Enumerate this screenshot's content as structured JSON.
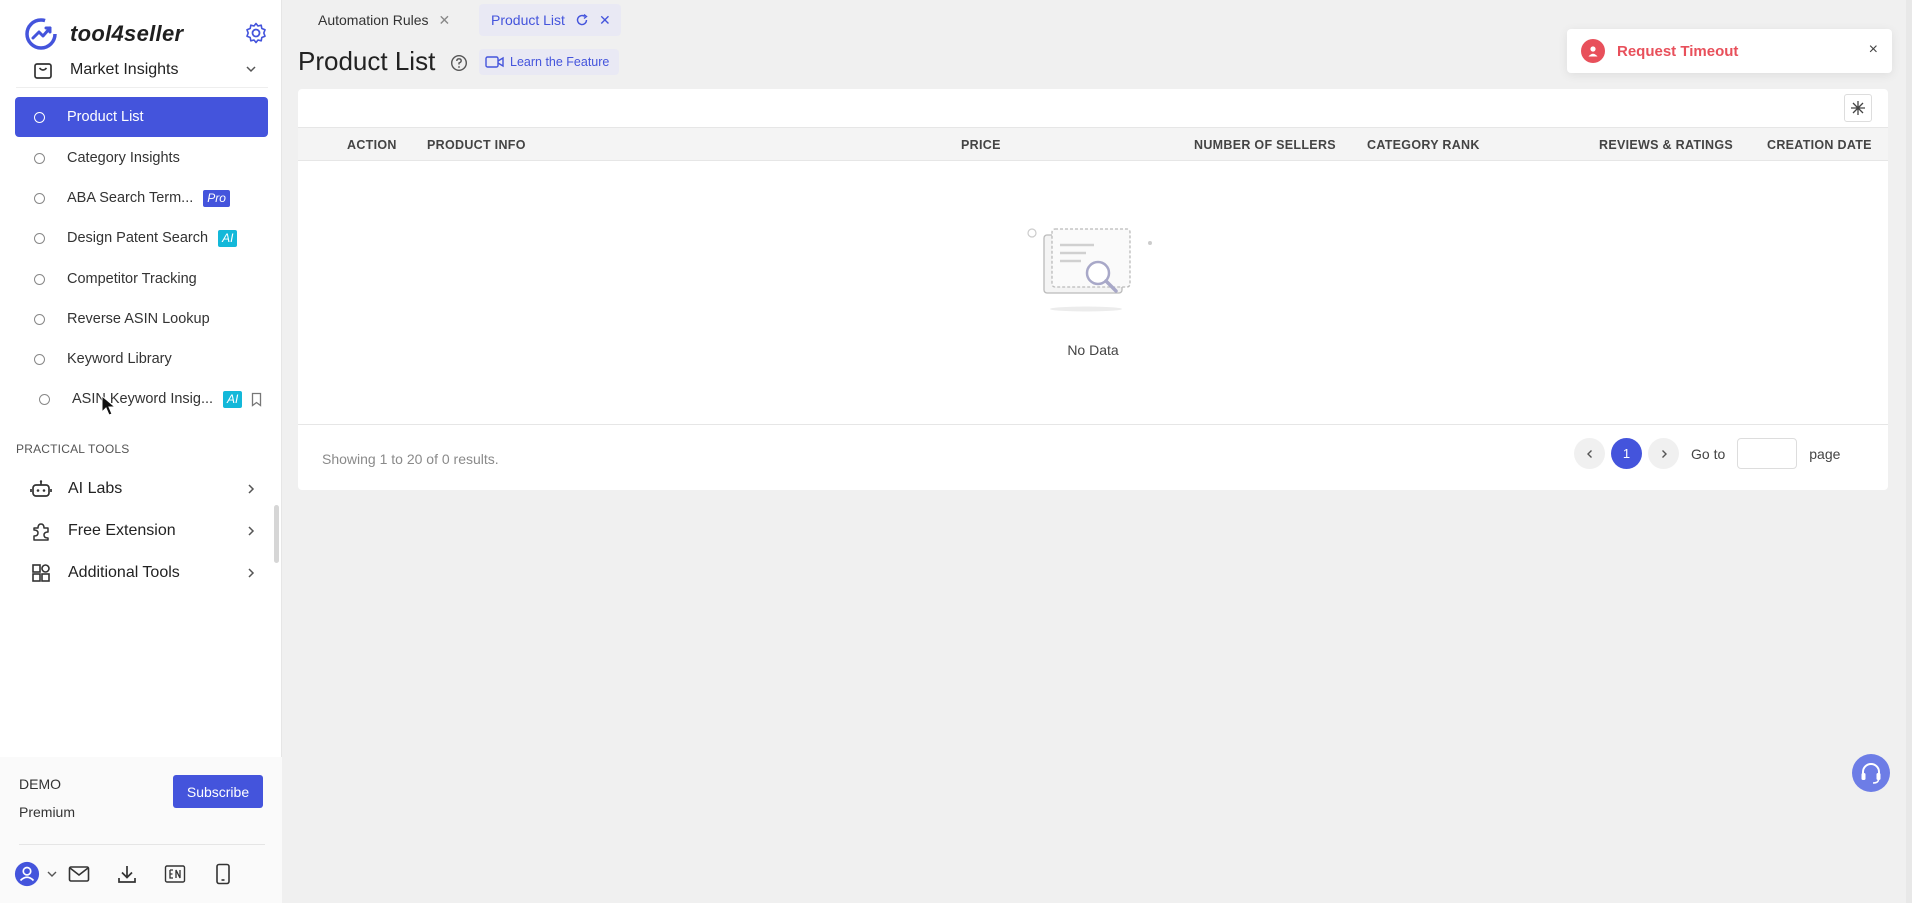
{
  "brand": {
    "name": "tool4seller"
  },
  "sidebar": {
    "group_label": "Market Insights",
    "items": [
      {
        "label": "Product List",
        "active": true,
        "tag": ""
      },
      {
        "label": "Category Insights",
        "tag": ""
      },
      {
        "label": "ABA Search Term...",
        "tag": "Pro"
      },
      {
        "label": "Design Patent Search",
        "tag": "AI"
      },
      {
        "label": "Competitor Tracking",
        "tag": ""
      },
      {
        "label": "Reverse ASIN Lookup",
        "tag": ""
      },
      {
        "label": "Keyword Library",
        "tag": ""
      },
      {
        "label": "ASIN Keyword Insig...",
        "tag": "AI"
      }
    ],
    "section_label": "PRACTICAL TOOLS",
    "tools": [
      {
        "label": "AI Labs",
        "icon": "robot-icon"
      },
      {
        "label": "Free Extension",
        "icon": "puzzle-icon"
      },
      {
        "label": "Additional Tools",
        "icon": "apps-icon"
      }
    ],
    "footer": {
      "account": "DEMO",
      "plan": "Premium",
      "subscribe_label": "Subscribe"
    }
  },
  "tabs": [
    {
      "label": "Automation Rules",
      "active": false
    },
    {
      "label": "Product List",
      "active": true
    }
  ],
  "page": {
    "title": "Product List",
    "learn_label": "Learn the Feature"
  },
  "table": {
    "columns": [
      "ACTION",
      "PRODUCT INFO",
      "PRICE",
      "NUMBER OF SELLERS",
      "CATEGORY RANK",
      "REVIEWS & RATINGS",
      "CREATION DATE"
    ],
    "empty_text": "No Data",
    "showing": "Showing 1 to 20 of 0 results.",
    "current_page": "1",
    "goto_label": "Go to",
    "page_label": "page"
  },
  "toast": {
    "message": "Request Timeout",
    "close": "×"
  },
  "colors": {
    "accent": "#4454dc",
    "ai_tag": "#13b8d9",
    "error": "#e8505b"
  }
}
